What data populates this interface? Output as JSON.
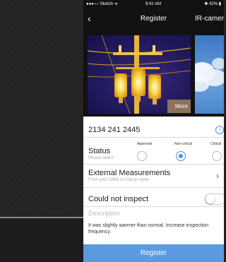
{
  "status_bar": {
    "carrier": "●●●○○ Sketch ᯤ",
    "time": "9:41 AM",
    "battery": "✱ 42% ▮"
  },
  "nav": {
    "back_icon": "chevron-left-icon",
    "title": "Register",
    "right_label": "IR-camera"
  },
  "gallery": {
    "more_label": "More"
  },
  "asset": {
    "number": "2134 241 2445",
    "info_icon": "info-icon"
  },
  "status": {
    "label": "Status",
    "hint": "Please select",
    "options": [
      {
        "label": "Approved",
        "selected": false
      },
      {
        "label": "Non-critical",
        "selected": true
      },
      {
        "label": "Critical",
        "selected": false
      }
    ],
    "accent_color": "#4a90e2"
  },
  "external": {
    "label": "External Measurements",
    "hint": "From your DMM or Clamp meter"
  },
  "inspect": {
    "label": "Could not inspect",
    "enabled": false
  },
  "description": {
    "placeholder": "Description",
    "text": "It was slightly warmer than normal. Increase inspection frequency."
  },
  "register_button": {
    "label": "Register",
    "color": "#5b9ae0"
  }
}
